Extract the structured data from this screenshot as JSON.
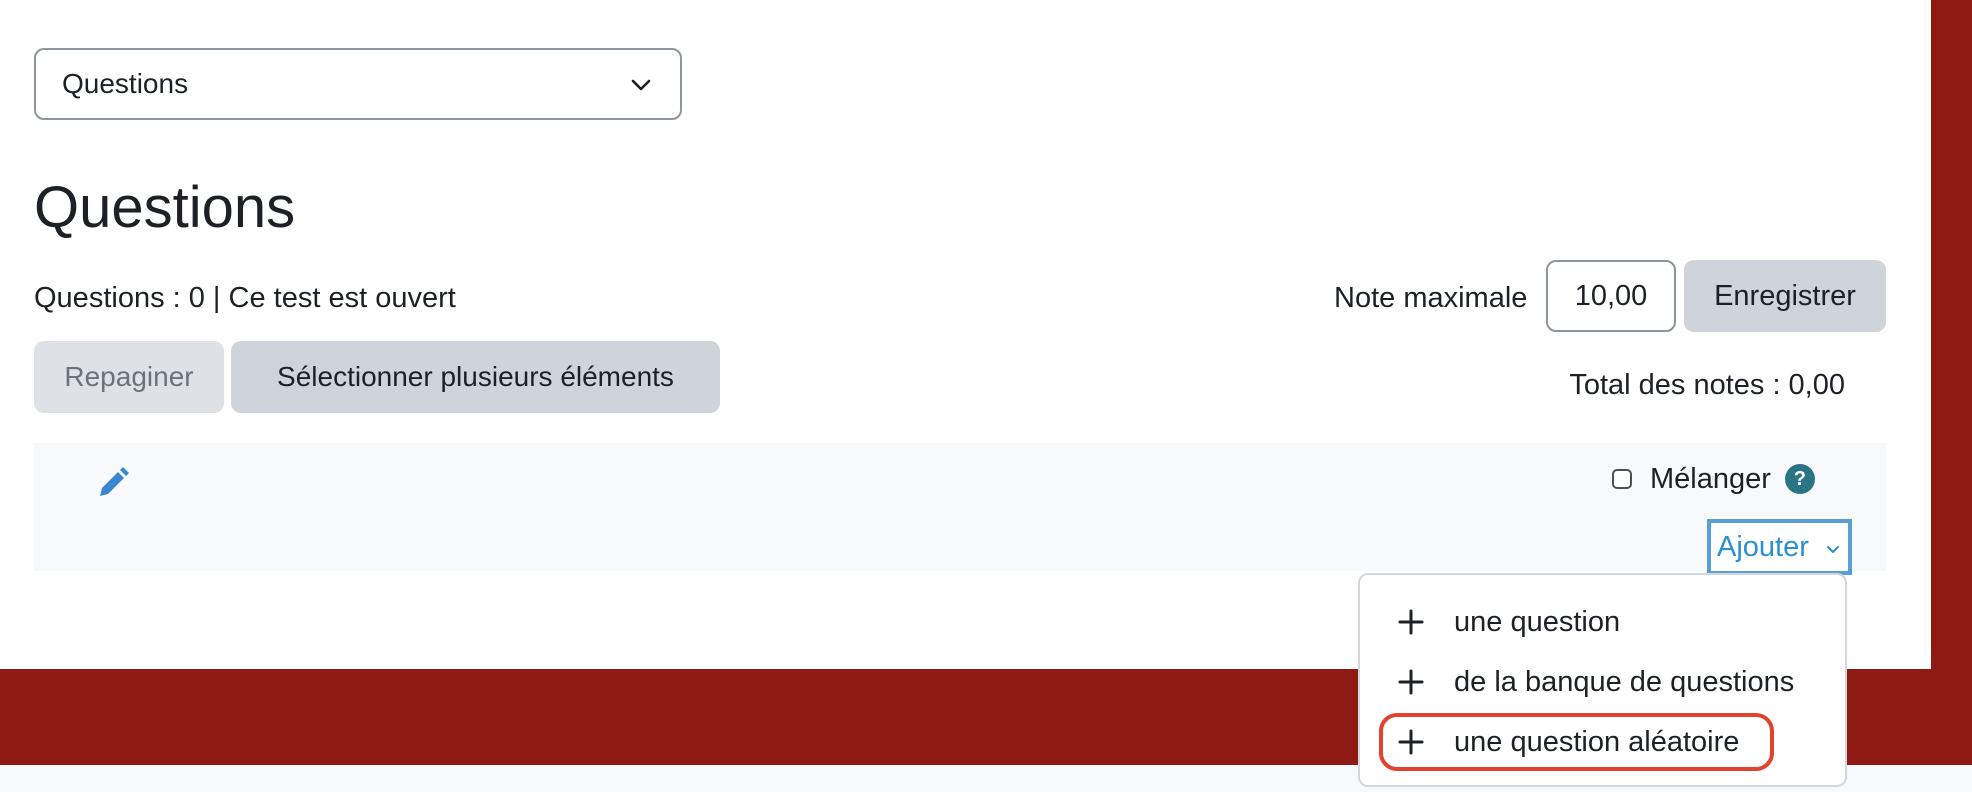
{
  "colors": {
    "brand_red": "#8f1a13",
    "link_blue": "#2b8fd3",
    "help_teal": "#2b7486",
    "highlight_red": "#e0442f"
  },
  "section_select": {
    "value": "Questions",
    "icon": "chevron-down-icon"
  },
  "page_title": "Questions",
  "info_line": "Questions : 0 | Ce test est ouvert",
  "buttons": {
    "repaginate": "Repaginer",
    "select_multiple": "Sélectionner plusieurs éléments",
    "save": "Enregistrer"
  },
  "max_grade": {
    "label": "Note maximale",
    "value": "10,00"
  },
  "total_grades": "Total des notes : 0,00",
  "section": {
    "edit_icon": "pencil-icon",
    "shuffle_label": "Mélanger",
    "shuffle_checked": false,
    "help_icon": "?",
    "add_label": "Ajouter"
  },
  "add_menu": {
    "items": [
      {
        "label": "une question",
        "icon": "plus-icon"
      },
      {
        "label": "de la banque de questions",
        "icon": "plus-icon"
      },
      {
        "label": "une question aléatoire",
        "icon": "plus-icon",
        "highlighted": true
      }
    ]
  }
}
